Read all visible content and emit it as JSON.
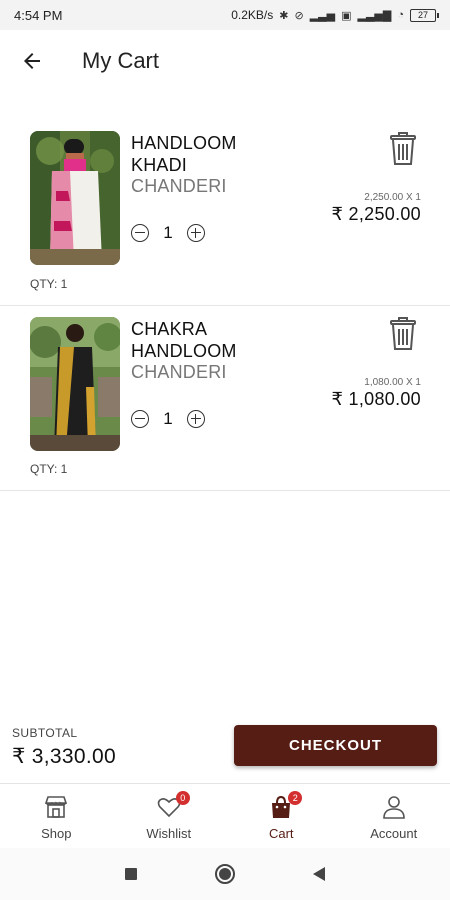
{
  "status_bar": {
    "time": "4:54 PM",
    "network_speed": "0.2KB/s",
    "battery": "27",
    "icons": [
      "bluetooth-icon",
      "alarm-off-icon",
      "signal-icon",
      "sim-icon",
      "signal-icon",
      "wifi-icon",
      "battery-icon"
    ]
  },
  "header": {
    "back_icon": "arrow-left-icon",
    "title": "My Cart"
  },
  "cart": {
    "items": [
      {
        "name": "HANDLOOM KHADI",
        "category": "CHANDERI",
        "quantity": "1",
        "unit_line": "2,250.00 X 1",
        "line_total": "₹ 2,250.00",
        "qty_label": "QTY: 1",
        "image": "saree-photo",
        "delete_icon": "trash-icon"
      },
      {
        "name": "CHAKRA HANDLOOM",
        "category": "CHANDERI",
        "quantity": "1",
        "unit_line": "1,080.00 X 1",
        "line_total": "₹ 1,080.00",
        "qty_label": "QTY: 1",
        "image": "saree-photo",
        "delete_icon": "trash-icon"
      }
    ]
  },
  "footer": {
    "subtotal_label": "SUBTOTAL",
    "subtotal_value": "₹ 3,330.00",
    "checkout_label": "CHECKOUT"
  },
  "bottom_nav": {
    "items": [
      {
        "label": "Shop",
        "icon": "store-icon",
        "active": false
      },
      {
        "label": "Wishlist",
        "icon": "heart-icon",
        "badge": "0",
        "active": false
      },
      {
        "label": "Cart",
        "icon": "shopping-bag-icon",
        "badge": "2",
        "active": true
      },
      {
        "label": "Account",
        "icon": "person-icon",
        "active": false
      }
    ]
  },
  "system_nav": {
    "icons": [
      "recents-square-icon",
      "home-circle-icon",
      "back-triangle-icon"
    ]
  },
  "colors": {
    "accent": "#561d14",
    "badge": "#d32f2f",
    "divider": "#e6e6e6"
  }
}
